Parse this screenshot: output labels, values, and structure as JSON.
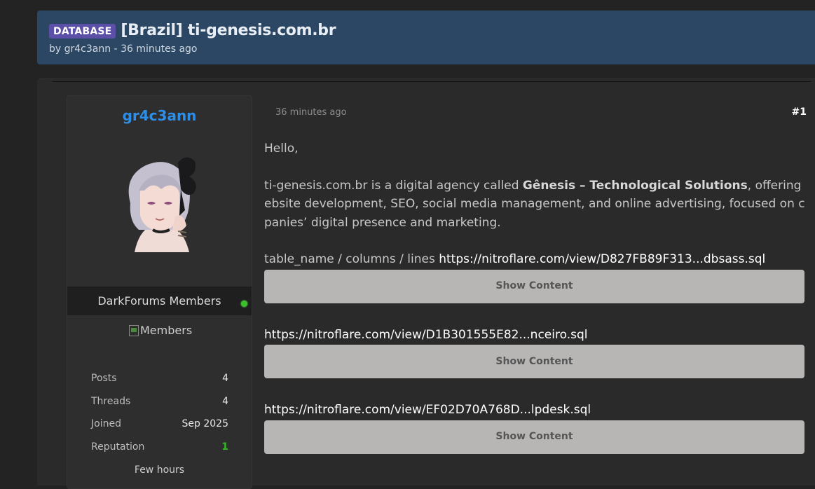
{
  "thread": {
    "prefix": "DATABASE",
    "title": "[Brazil] ti-genesis.com.br",
    "meta_by": "by ",
    "author": "gr4c3ann",
    "meta_sep": " - ",
    "time": "36 minutes ago"
  },
  "user": {
    "username": "gr4c3ann",
    "usergroup": "DarkForums Members",
    "group_image_alt": "Members",
    "stats": [
      {
        "label": "Posts",
        "value": "4"
      },
      {
        "label": "Threads",
        "value": "4"
      },
      {
        "label": "Joined",
        "value": "Sep 2025"
      },
      {
        "label": "Reputation",
        "value": "1"
      }
    ],
    "last_seen": "Few hours"
  },
  "post": {
    "date": "36 minutes ago",
    "number": "#1",
    "greeting": "Hello,",
    "desc_1a": "ti-genesis.com.br is a digital agency called ",
    "desc_bold": "Gênesis – Technological Solutions",
    "desc_1b": ", offering w",
    "desc_2": "ebsite development, SEO, social media management, and online advertising, focused on com",
    "desc_3": "panies’ digital presence and marketing.",
    "links_prefix": "table_name / columns / lines ",
    "links": [
      "https://nitroflare.com/view/D827FB89F313...dbsass.sql",
      "https://nitroflare.com/view/D1B301555E82...nceiro.sql",
      "https://nitroflare.com/view/EF02D70A768D...lpdesk.sql"
    ],
    "show_content_label": "Show Content"
  },
  "colors": {
    "header_bg": "#2b4763",
    "prefix_badge": "#5b4fa8",
    "username": "#2d8ee8",
    "reputation": "#39b42a",
    "online": "#3bbf2a"
  }
}
